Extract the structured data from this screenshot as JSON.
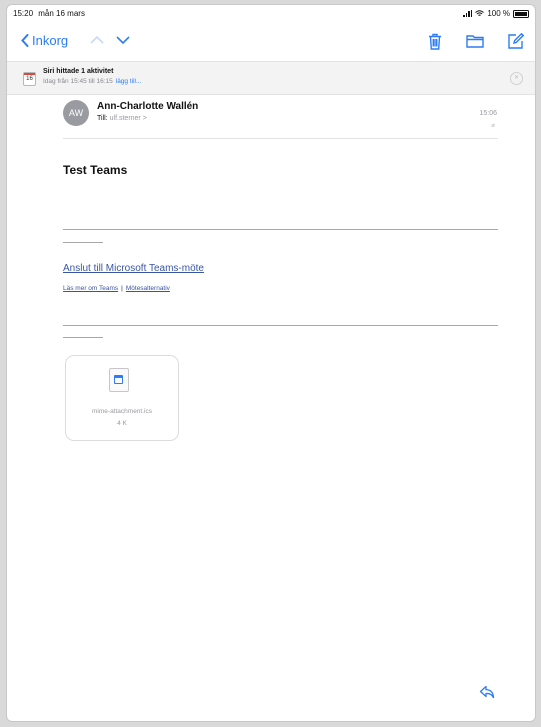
{
  "status_bar": {
    "time": "15:20",
    "date": "mån 16 mars",
    "battery": "100 %"
  },
  "toolbar": {
    "back_label": "Inkorg"
  },
  "siri": {
    "calendar_day": "16",
    "title": "Siri hittade 1 aktivitet",
    "subtitle": "Idag från 15:45 till 16:15",
    "add_link": "lägg till..."
  },
  "message": {
    "avatar_initials": "AW",
    "sender": "Ann-Charlotte Wallén",
    "to_label": "Till:",
    "to_address": "ulf.sterner >",
    "time": "15:06",
    "subject": "Test Teams"
  },
  "body": {
    "join_link": "Anslut till Microsoft Teams-möte",
    "learn_more": "Läs mer om Teams",
    "separator": "|",
    "meeting_options": "Mötesalternativ"
  },
  "attachment": {
    "filename": "mime-attachment.ics",
    "size": "4 K"
  },
  "colors": {
    "accent": "#2b7cf6",
    "link": "#3a56a3"
  }
}
